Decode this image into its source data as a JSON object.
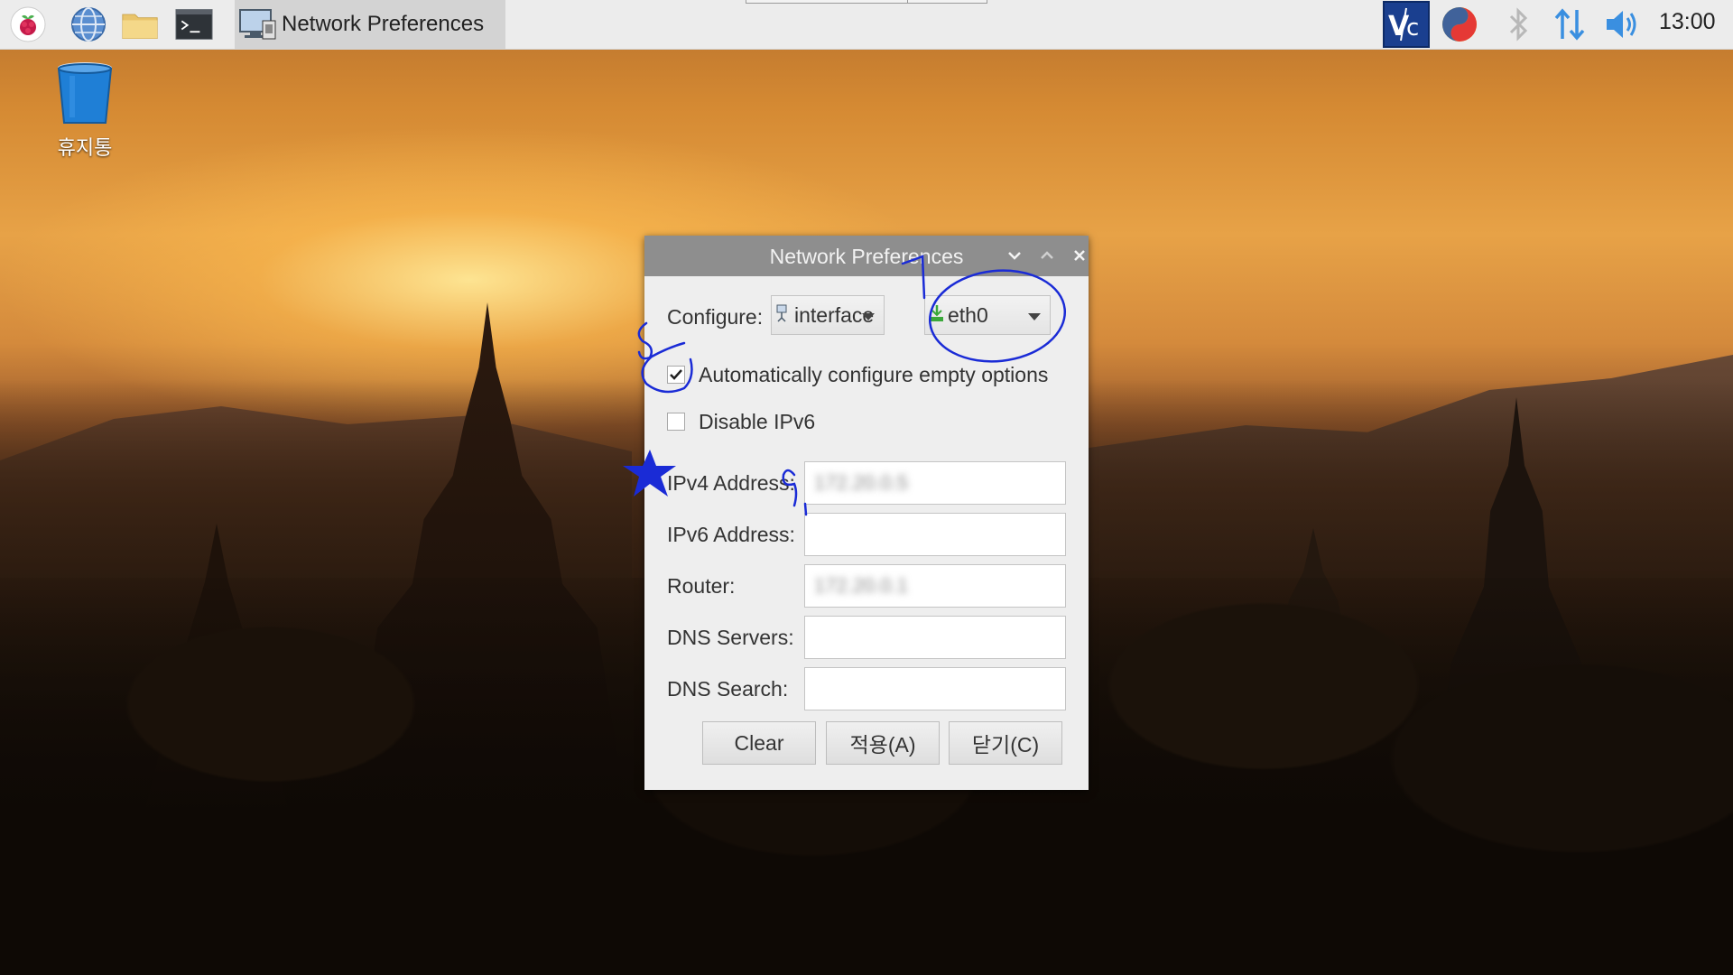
{
  "taskbar": {
    "launchers": [
      {
        "icon": "raspberry-menu-icon"
      },
      {
        "icon": "web-browser-icon"
      },
      {
        "icon": "file-manager-icon"
      },
      {
        "icon": "terminal-icon"
      }
    ],
    "active_window": {
      "icon": "network-preferences-icon",
      "title": "Network Preferences"
    },
    "tray": [
      {
        "icon": "vnc-icon"
      },
      {
        "icon": "input-method-icon"
      },
      {
        "icon": "bluetooth-icon"
      },
      {
        "icon": "network-updown-icon"
      },
      {
        "icon": "volume-icon"
      }
    ],
    "clock": "13:00"
  },
  "desktop": {
    "trash_label": "휴지통"
  },
  "dialog": {
    "title": "Network Preferences",
    "configure_label": "Configure:",
    "configure_type": "interface",
    "configure_target": "eth0",
    "auto_configure_label": "Automatically configure empty options",
    "auto_configure_checked": true,
    "disable_ipv6_label": "Disable IPv6",
    "disable_ipv6_checked": false,
    "fields": {
      "ipv4_label": "IPv4 Address:",
      "ipv4_value": "172.20.0.5",
      "ipv6_label": "IPv6 Address:",
      "ipv6_value": "",
      "router_label": "Router:",
      "router_value": "172.20.0.1",
      "dns_servers_label": "DNS Servers:",
      "dns_servers_value": "",
      "dns_search_label": "DNS Search:",
      "dns_search_value": ""
    },
    "buttons": {
      "clear": "Clear",
      "apply": "적용(A)",
      "close": "닫기(C)"
    }
  },
  "colors": {
    "titlebar": "#8e8e8e",
    "dialog_bg": "#eeeeee",
    "annotation_ink": "#1a2bd6"
  }
}
